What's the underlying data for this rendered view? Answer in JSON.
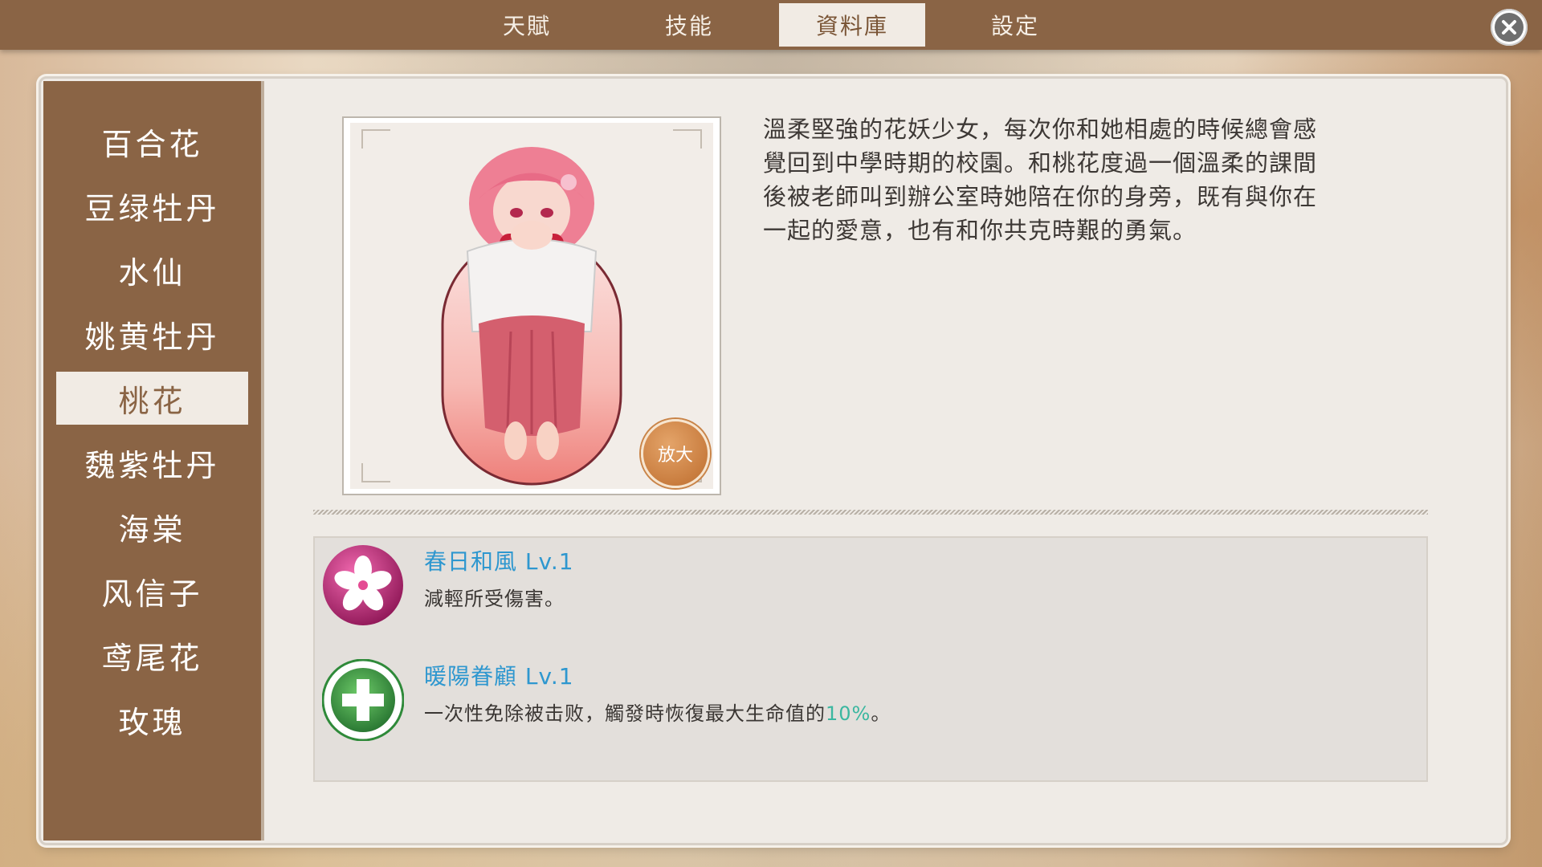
{
  "tabs": [
    {
      "label": "天賦"
    },
    {
      "label": "技能"
    },
    {
      "label": "資料庫",
      "active": true
    },
    {
      "label": "設定"
    }
  ],
  "close_icon": "close-icon",
  "sidebar": {
    "items": [
      {
        "label": "百合花"
      },
      {
        "label": "豆绿牡丹"
      },
      {
        "label": "水仙"
      },
      {
        "label": "姚黄牡丹"
      },
      {
        "label": "桃花",
        "selected": true
      },
      {
        "label": "魏紫牡丹"
      },
      {
        "label": "海棠"
      },
      {
        "label": "风信子"
      },
      {
        "label": "鸢尾花"
      },
      {
        "label": "玫瑰"
      }
    ]
  },
  "portrait": {
    "zoom_label": "放大",
    "image": "pink-haired-flower-girl-portrait"
  },
  "description": {
    "lines": [
      "溫柔堅強的花妖少女，每次你和她相處的時候總會感",
      "覺回到中學時期的校園。和桃花度過一個溫柔的課間",
      "後被老師叫到辦公室時她陪在你的身旁，既有與你在",
      "一起的愛意，也有和你共克時艱的勇氣。"
    ]
  },
  "skills": [
    {
      "name": "春日和風 Lv.1",
      "desc": "減輕所受傷害。",
      "icon": "sakura-flower-icon",
      "color": "#c8297d"
    },
    {
      "name": "暖陽眷顧 Lv.1",
      "desc_prefix": "一次性免除被击败，觸發時恢復最大生命值的",
      "desc_highlight": "10%",
      "desc_suffix": "。",
      "icon": "green-cross-heal-icon",
      "color": "#2f8a3a"
    }
  ],
  "colors": {
    "topbar": "#8a6445",
    "accent_text": "#2e97cf",
    "highlight": "#3bb7a0"
  }
}
